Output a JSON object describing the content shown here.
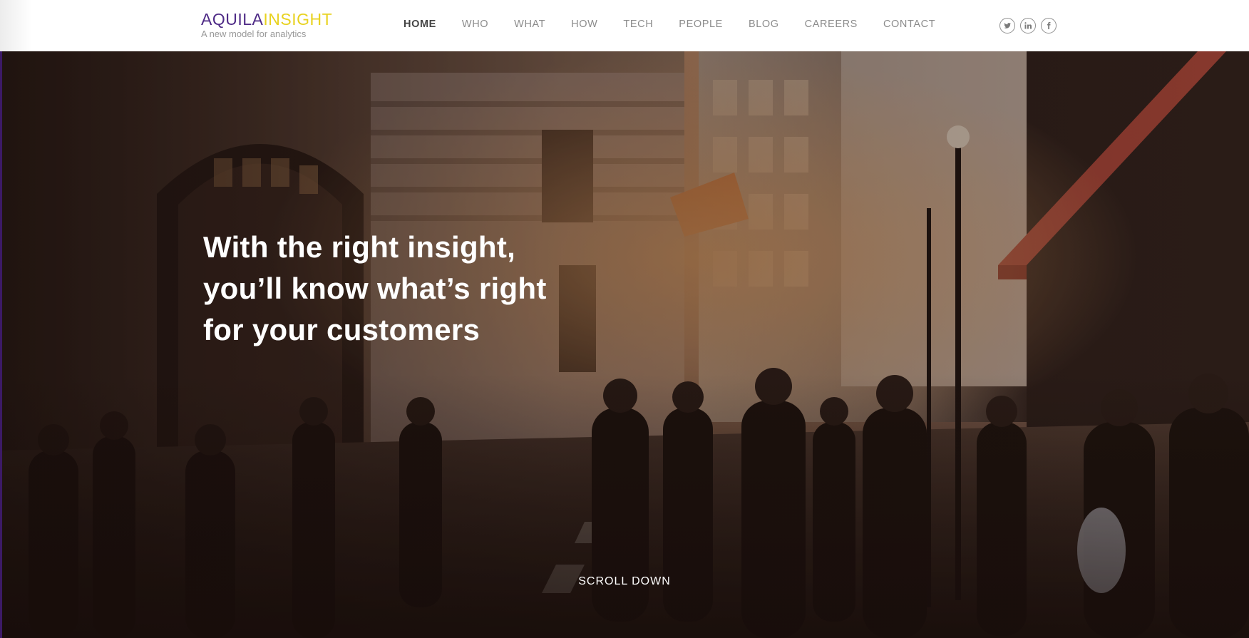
{
  "brand": {
    "word_part1": "AQUILA",
    "word_part2": "INSIGHT",
    "tagline": "A new model for analytics",
    "color_primary": "#4e2a86",
    "color_secondary": "#e8d21f"
  },
  "nav": {
    "items": [
      {
        "label": "HOME",
        "active": true
      },
      {
        "label": "WHO",
        "active": false
      },
      {
        "label": "WHAT",
        "active": false
      },
      {
        "label": "HOW",
        "active": false
      },
      {
        "label": "TECH",
        "active": false
      },
      {
        "label": "PEOPLE",
        "active": false
      },
      {
        "label": "BLOG",
        "active": false
      },
      {
        "label": "CAREERS",
        "active": false
      },
      {
        "label": "CONTACT",
        "active": false
      }
    ]
  },
  "social": {
    "icons": [
      "twitter-icon",
      "linkedin-icon",
      "facebook-icon"
    ]
  },
  "hero": {
    "headline_lines": [
      "With the right insight,",
      "you’ll know what’s right",
      "for your customers"
    ],
    "scroll_label": "SCROLL DOWN",
    "image_subject": "busy city street crowd at sunset"
  }
}
